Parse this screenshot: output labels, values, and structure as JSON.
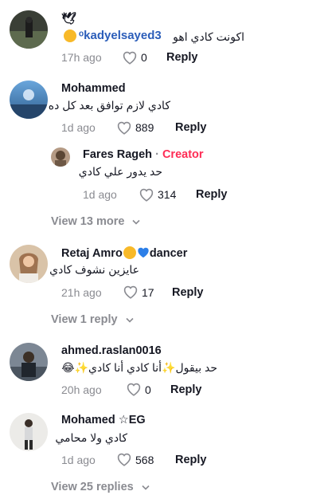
{
  "comments": [
    {
      "username": "🕊",
      "text": "اكونت كادي اهو",
      "mention": "kadyelsayed3",
      "time": "17h ago",
      "likes": "0",
      "reply_label": "Reply"
    },
    {
      "username": "Mohammed",
      "text": "كادي لازم توافق بعد كل ده",
      "time": "1d ago",
      "likes": "889",
      "reply_label": "Reply",
      "reply": {
        "username": "Fares Rageh",
        "separator": "·",
        "badge": "Creator",
        "text": "حد يدور علي كادي",
        "time": "1d ago",
        "likes": "314",
        "reply_label": "Reply"
      },
      "view_more": "View 13 more"
    },
    {
      "username": "Retaj Amro",
      "username_suffix": "dancer",
      "text": "عايزين نشوف كادي",
      "time": "21h ago",
      "likes": "17",
      "reply_label": "Reply",
      "view_more": "View 1 reply"
    },
    {
      "username": "ahmed.raslan0016",
      "text": "حد بيقول✨أنا كادي أنا كادي✨😂",
      "time": "20h ago",
      "likes": "0",
      "reply_label": "Reply"
    },
    {
      "username": "Mohamed ☆EG",
      "text": "كادي ولا محامي",
      "time": "1d ago",
      "likes": "568",
      "reply_label": "Reply",
      "view_more": "View 25 replies"
    }
  ],
  "colors": {
    "text": "#161823",
    "muted": "#8a8b91",
    "creator": "#fe2c55",
    "mention": "#2b5db9"
  },
  "icons": [
    "heart-outline-icon",
    "chevron-down-icon",
    "heart-blue-icon",
    "sparkles-icon",
    "laughing-emoji-icon",
    "kissing-emoji-icon"
  ]
}
